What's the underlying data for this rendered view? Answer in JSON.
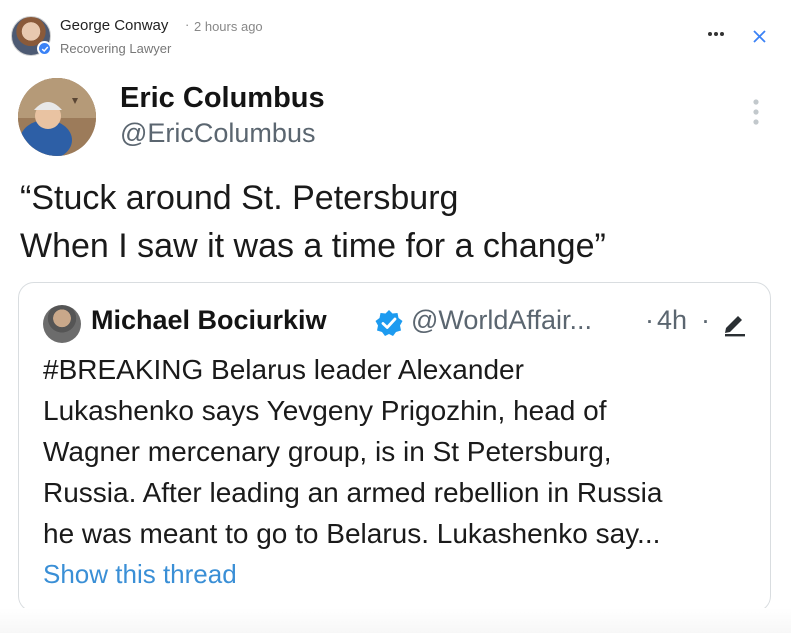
{
  "post": {
    "author_name": "George Conway",
    "dot": "·",
    "time": "2 hours ago",
    "subtitle": "Recovering Lawyer",
    "more_icon": "more-horizontal-icon",
    "close_icon": "close-icon",
    "accent_color": "#3b82f6"
  },
  "tweet": {
    "name": "Eric Columbus",
    "handle": "@EricColumbus",
    "text_lines": [
      "“Stuck around St. Petersburg",
      "When I saw it was a time for a change”"
    ]
  },
  "quoted_tweet": {
    "name": "Michael Bociurkiw",
    "handle": "@WorldAffair...",
    "dot": "·",
    "time": "4h",
    "text_lines": [
      "#BREAKING Belarus leader Alexander",
      "Lukashenko says Yevgeny Prigozhin, head of",
      "Wagner mercenary group, is in St Petersburg,",
      "Russia. After leading an armed rebellion in Russia",
      "he was meant to go to Belarus. Lukashenko say..."
    ],
    "show_thread": "Show this thread",
    "link_color": "#3a8fd6",
    "verified_color": "#1d9bf0"
  }
}
